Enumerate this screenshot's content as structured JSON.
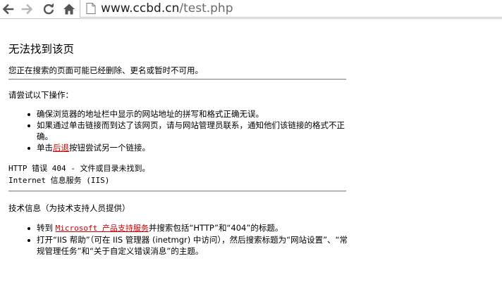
{
  "browser": {
    "url_host": "www.ccbd.cn",
    "url_path": "/test.php"
  },
  "page": {
    "title": "无法找到该页",
    "intro": "您正在搜索的页面可能已经删除、更名或暂时不可用。",
    "try_heading": "请尝试以下操作：",
    "steps": {
      "0": "确保浏览器的地址栏中显示的网站地址的拼写和格式正确无误。",
      "1": "如果通过单击链接而到达了该网页，请与网站管理员联系，通知他们该链接的格式不正确。",
      "2_prefix": "单击",
      "2_link": "后退",
      "2_suffix": "按钮尝试另一个链接。"
    },
    "error_line": "HTTP 错误 404 - 文件或目录未找到。",
    "server_line": "Internet 信息服务 (IIS)",
    "tech_heading": "技术信息（为技术支持人员提供）",
    "tech": {
      "0_prefix": "转到 ",
      "0_link": "Microsoft 产品支持服务",
      "0_suffix": "并搜索包括“HTTP”和“404”的标题。",
      "1": "打开“IIS 帮助”（可在 IIS 管理器 (inetmgr) 中访问），然后搜索标题为“网站设置”、“常规管理任务”和“关于自定义错误消息”的主题。"
    }
  },
  "icons": {
    "back": "back-arrow-icon",
    "forward": "forward-arrow-icon",
    "reload": "reload-icon",
    "home": "home-icon",
    "page": "page-icon"
  },
  "colors": {
    "link": "#cc0000",
    "rule": "#8c8c8c"
  }
}
